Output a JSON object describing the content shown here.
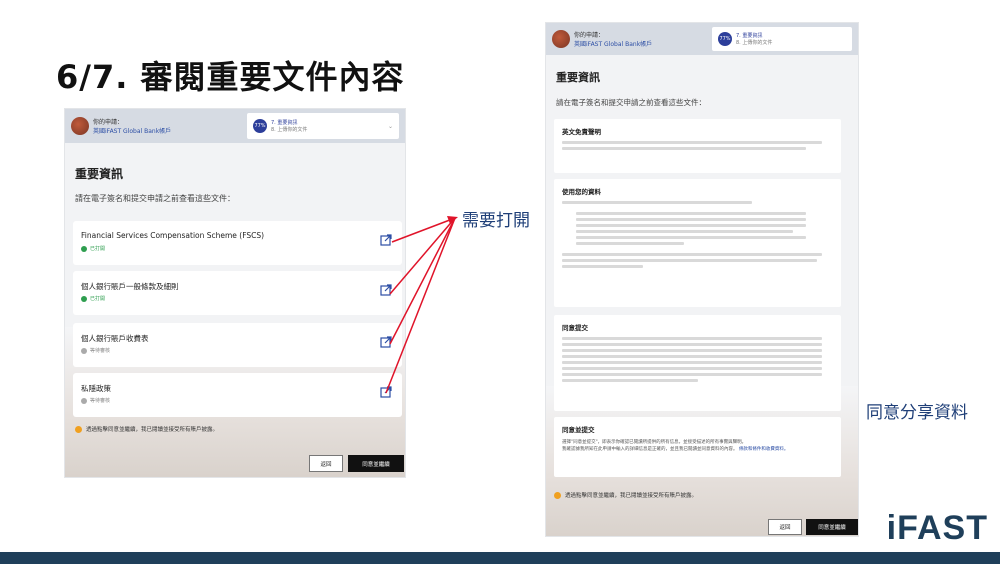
{
  "slide": {
    "title": "6/7. 審閱重要文件內容",
    "annot_open": "需要打開",
    "annot_share": "同意分享資料",
    "brand": "iFAST"
  },
  "colors": {
    "accent": "#2c3e9a",
    "brand": "#1f3f5a",
    "annotation_arrow": "#e0142a",
    "ok": "#2e9e4f",
    "pending": "#888888"
  },
  "header": {
    "applying_label": "你的申請：",
    "account_name": "英國iFAST Global Bank帳戶",
    "step_percent": "77%",
    "step_current": "7. 重要資訊",
    "step_next": "8. 上傳你的文件"
  },
  "left": {
    "section_title": "重要資訊",
    "section_sub": "請在電子簽名和提交申請之前查看這些文件：",
    "docs": [
      {
        "name": "Financial Services Compensation Scheme (FSCS)",
        "status": "已打開",
        "state": "ok",
        "icon": "external-link-icon"
      },
      {
        "name": "個人銀行賬戶一般條款及細則",
        "status": "已打開",
        "state": "ok",
        "icon": "external-link-icon"
      },
      {
        "name": "個人銀行賬戶收費表",
        "status": "等待審核",
        "state": "pending",
        "icon": "external-link-icon"
      },
      {
        "name": "私隱政策",
        "status": "等待審核",
        "state": "pending",
        "icon": "external-link-icon"
      }
    ],
    "notice": "透過點擊同意並繼續，我已閱讀並接受所有賬戶披露。",
    "back_button": "返回",
    "agree_button": "同意並繼續"
  },
  "right": {
    "section_title": "重要資訊",
    "section_sub": "請在電子簽名和提交申請之前查看這些文件：",
    "cards": {
      "disclaimer_title": "英文免責聲明",
      "data_title": "使用您的資料",
      "consent_title": "同意提交",
      "final_title": "同意並提交",
      "final_text1": "選擇\"同意並提交\"，即表示你確認已閱讀所提供的所有信息，並接受描述的所有事實與聲明。",
      "final_text2": "我確認據我所知在此申請中輸入的詳細信息是正確的，並且我已閱讀並同意資料的內容。",
      "final_link": "條款和條件和收費資料。"
    },
    "notice": "透過點擊同意並繼續，我已閱讀並接受所有賬戶披露。",
    "back_button": "返回",
    "agree_button": "同意並繼續"
  }
}
